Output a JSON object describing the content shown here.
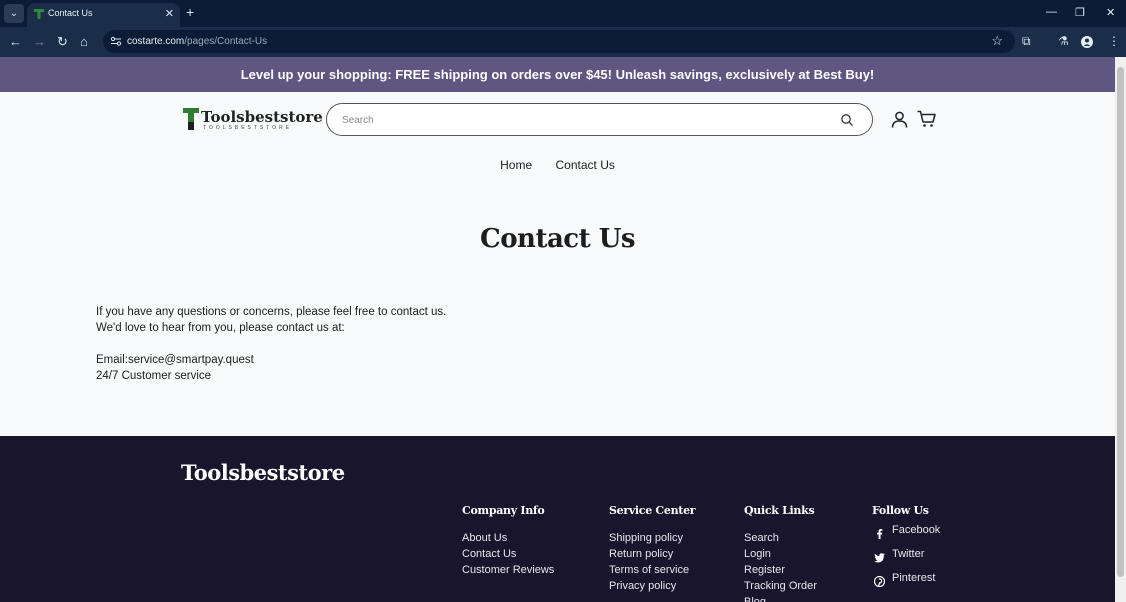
{
  "browser": {
    "tab_title": "Contact Us",
    "url_domain": "costarte.com",
    "url_path": "/pages/Contact-Us"
  },
  "announcement": "Level up your shopping: FREE shipping on orders over $45! Unleash savings, exclusively at Best Buy!",
  "header": {
    "logo_text": "Toolsbeststore",
    "logo_sub": "TOOLSBESTSTORE",
    "search_placeholder": "Search",
    "nav": [
      "Home",
      "Contact Us"
    ]
  },
  "main": {
    "title": "Contact Us",
    "line1": "If you have any questions or concerns, please feel free to contact us.",
    "line2": "We'd love to hear from you, please contact us at:",
    "email": "Email:service@smartpay.quest",
    "service": "24/7 Customer service"
  },
  "footer": {
    "logo": "Toolsbeststore",
    "company": {
      "heading": "Company Info",
      "links": [
        "About Us",
        "Contact Us",
        "Customer Reviews"
      ]
    },
    "service": {
      "heading": "Service Center",
      "links": [
        "Shipping policy",
        "Return policy",
        "Terms of service",
        "Privacy policy"
      ]
    },
    "quick": {
      "heading": "Quick Links",
      "links": [
        "Search",
        "Login",
        "Register",
        "Tracking Order",
        "Blog"
      ]
    },
    "follow": {
      "heading": "Follow Us",
      "links": [
        "Facebook",
        "Twitter",
        "Pinterest"
      ]
    }
  },
  "colors": {
    "announcement_bg": "#5f5682",
    "footer_bg": "#18152c",
    "browser_frame": "#0b1d36"
  }
}
